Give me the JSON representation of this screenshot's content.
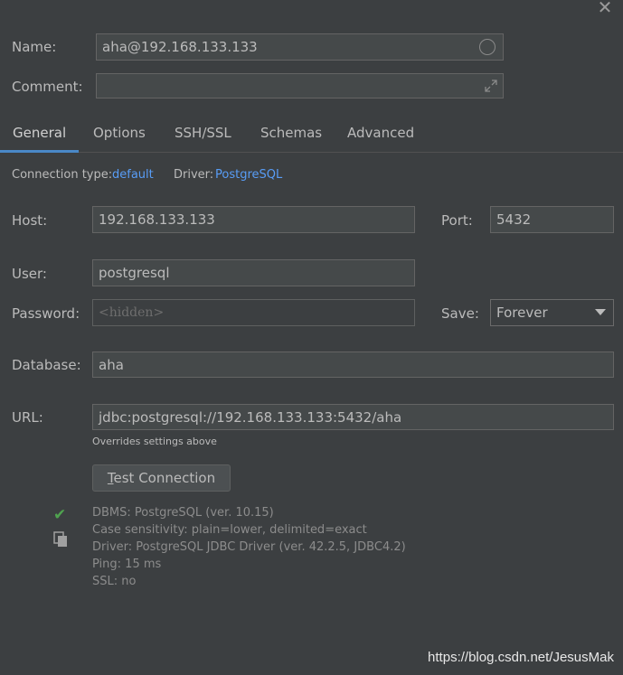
{
  "form": {
    "name_label": "Name:",
    "name_value": "aha@192.168.133.133",
    "comment_label": "Comment:",
    "comment_value": ""
  },
  "tabs": [
    {
      "label": "General",
      "active": true
    },
    {
      "label": "Options",
      "active": false
    },
    {
      "label": "SSH/SSL",
      "active": false
    },
    {
      "label": "Schemas",
      "active": false
    },
    {
      "label": "Advanced",
      "active": false
    }
  ],
  "connection": {
    "type_label": "Connection type:",
    "type_value": "default",
    "driver_label": "Driver:",
    "driver_value": "PostgreSQL"
  },
  "general": {
    "host_label": "Host:",
    "host_value": "192.168.133.133",
    "port_label": "Port:",
    "port_value": "5432",
    "user_label": "User:",
    "user_value": "postgresql",
    "password_label": "Password:",
    "password_placeholder": "<hidden>",
    "save_label": "Save:",
    "save_value": "Forever",
    "database_label": "Database:",
    "database_value": "aha",
    "url_label": "URL:",
    "url_value": "jdbc:postgresql://192.168.133.133:5432/aha",
    "url_hint": "Overrides settings above"
  },
  "test": {
    "button_mnemonic": "T",
    "button_rest": "est Connection",
    "results": [
      "DBMS: PostgreSQL (ver. 10.15)",
      "Case sensitivity: plain=lower, delimited=exact",
      "Driver: PostgreSQL JDBC Driver (ver. 42.2.5, JDBC4.2)",
      "Ping: 15 ms",
      "SSL: no"
    ]
  },
  "icons": {
    "close": "close-icon",
    "name_status": "circle-icon",
    "expand": "expand-icon",
    "dropdown": "triangle-down-icon",
    "success": "check-icon",
    "copy": "copy-icon"
  },
  "colors": {
    "background": "#3c3f41",
    "field_bg": "#45494a",
    "accent": "#4a88c7",
    "link": "#589df6",
    "success": "#4fa34f"
  },
  "watermark": "https://blog.csdn.net/JesusMak"
}
